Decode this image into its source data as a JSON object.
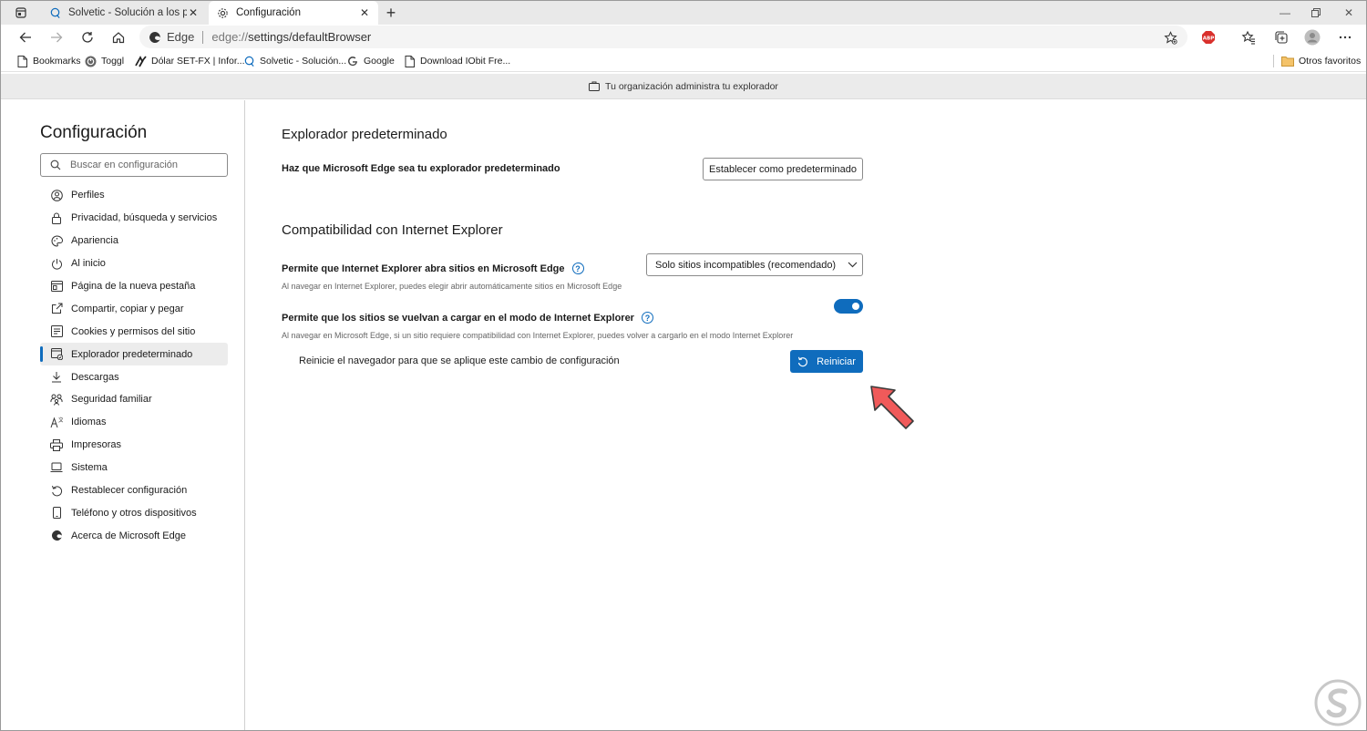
{
  "tabs": [
    {
      "title": "Solvetic - Solución a los problem",
      "icon": "search-icon"
    },
    {
      "title": "Configuración",
      "icon": "gear-icon"
    }
  ],
  "address": {
    "brand": "Edge",
    "scheme": "edge://",
    "path": "settings/defaultBrowser"
  },
  "bookmarks": [
    {
      "label": "Bookmarks",
      "icon": "page-icon"
    },
    {
      "label": "Toggl",
      "icon": "toggl-icon"
    },
    {
      "label": "Dólar SET-FX | Infor...",
      "icon": "set-fx-icon"
    },
    {
      "label": "Solvetic - Solución...",
      "icon": "search-icon"
    },
    {
      "label": "Google",
      "icon": "google-icon"
    },
    {
      "label": "Download IObit Fre...",
      "icon": "page-icon"
    }
  ],
  "other_favorites": "Otros favoritos",
  "managed_banner": "Tu organización administra tu explorador",
  "sidebar": {
    "title": "Configuración",
    "search_placeholder": "Buscar en configuración",
    "items": [
      {
        "label": "Perfiles",
        "icon": "profile-icon"
      },
      {
        "label": "Privacidad, búsqueda y servicios",
        "icon": "lock-icon"
      },
      {
        "label": "Apariencia",
        "icon": "palette-icon"
      },
      {
        "label": "Al inicio",
        "icon": "power-icon"
      },
      {
        "label": "Página de la nueva pestaña",
        "icon": "new-tab-page-icon"
      },
      {
        "label": "Compartir, copiar y pegar",
        "icon": "share-icon"
      },
      {
        "label": "Cookies y permisos del sitio",
        "icon": "cookies-icon"
      },
      {
        "label": "Explorador predeterminado",
        "icon": "default-browser-icon"
      },
      {
        "label": "Descargas",
        "icon": "download-icon"
      },
      {
        "label": "Seguridad familiar",
        "icon": "family-icon"
      },
      {
        "label": "Idiomas",
        "icon": "language-icon"
      },
      {
        "label": "Impresoras",
        "icon": "printer-icon"
      },
      {
        "label": "Sistema",
        "icon": "laptop-icon"
      },
      {
        "label": "Restablecer configuración",
        "icon": "reset-icon"
      },
      {
        "label": "Teléfono y otros dispositivos",
        "icon": "phone-icon"
      },
      {
        "label": "Acerca de Microsoft Edge",
        "icon": "edge-logo-icon"
      }
    ],
    "selected": "Explorador predeterminado"
  },
  "main": {
    "default_browser": {
      "title": "Explorador predeterminado",
      "label": "Haz que Microsoft Edge sea tu explorador predeterminado",
      "button": "Establecer como predeterminado"
    },
    "ie_compat": {
      "title": "Compatibilidad con Internet Explorer",
      "allow_ie_label": "Permite que Internet Explorer abra sitios en Microsoft Edge",
      "allow_ie_desc": "Al navegar en Internet Explorer, puedes elegir abrir automáticamente sitios en Microsoft Edge",
      "dropdown_value": "Solo sitios incompatibles (recomendado)",
      "reload_label": "Permite que los sitios se vuelvan a cargar en el modo de Internet Explorer",
      "reload_desc": "Al navegar en Microsoft Edge, si un sitio requiere compatibilidad con Internet Explorer, puedes volver a cargarlo en el modo Internet Explorer",
      "toggle_on": true,
      "restart_message": "Reinicie el navegador para que se aplique este cambio de configuración",
      "restart_button": "Reiniciar"
    }
  },
  "colors": {
    "accent": "#0f6cbd",
    "pointer": "#f05a5a",
    "selected_bg": "#ececec",
    "banner_bg": "#ebebeb"
  }
}
